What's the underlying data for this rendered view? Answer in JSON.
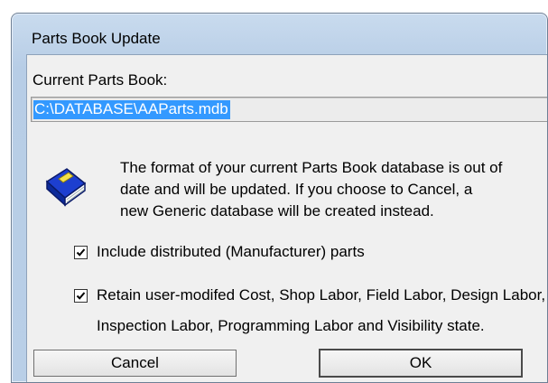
{
  "window": {
    "title": "Parts Book Update"
  },
  "current_parts_book": {
    "label": "Current Parts Book:",
    "path": "C:\\DATABASE\\AAParts.mdb"
  },
  "message": {
    "icon": "book-icon",
    "lines": [
      "The format of your current Parts Book database is out of",
      "date and will be updated.  If you choose to Cancel, a",
      "new Generic database will be created instead."
    ]
  },
  "options": {
    "include_distributed": {
      "label": "Include distributed (Manufacturer) parts",
      "checked": true
    },
    "retain_user_modified": {
      "label_line1": "Retain user-modifed Cost, Shop Labor, Field Labor, Design Labor,",
      "label_line2": "Inspection Labor, Programming Labor and Visibility state.",
      "checked": true
    }
  },
  "buttons": {
    "cancel": "Cancel",
    "ok": "OK"
  },
  "colors": {
    "selection": "#3399ff",
    "frame": "#b9cfe7",
    "client": "#f0f0f0"
  }
}
